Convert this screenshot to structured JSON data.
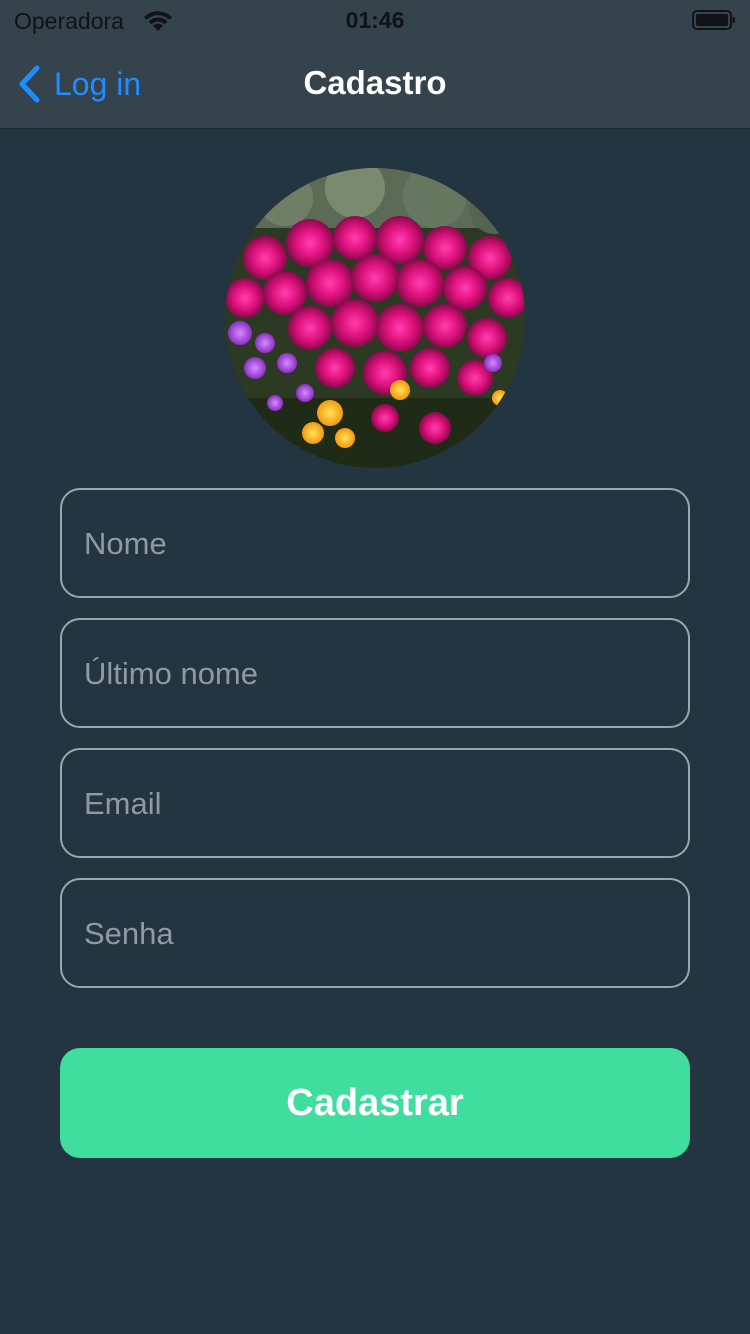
{
  "status_bar": {
    "carrier": "Operadora",
    "time": "01:46",
    "wifi_icon": "wifi-icon",
    "battery_icon": "battery-icon"
  },
  "nav": {
    "back_label": "Log in",
    "back_icon": "chevron-left-icon",
    "title": "Cadastro"
  },
  "avatar": {
    "description_icon": "profile-photo"
  },
  "form": {
    "first_name": {
      "placeholder": "Nome",
      "value": ""
    },
    "last_name": {
      "placeholder": "Último nome",
      "value": ""
    },
    "email": {
      "placeholder": "Email",
      "value": ""
    },
    "password": {
      "placeholder": "Senha",
      "value": ""
    }
  },
  "submit_label": "Cadastrar",
  "colors": {
    "background": "#223540",
    "nav_background": "#34434c",
    "accent_blue": "#1f8dff",
    "button_green": "#3fde9e",
    "field_border": "#9aa7ae"
  }
}
